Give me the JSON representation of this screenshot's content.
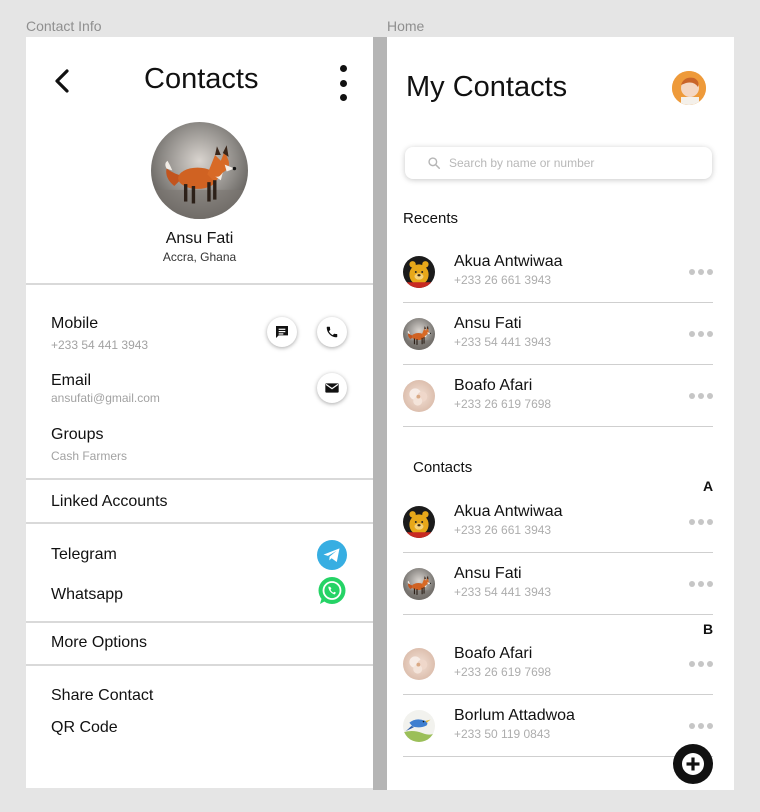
{
  "canvas": {
    "left_frame_label": "Contact Info",
    "right_frame_label": "Home"
  },
  "contact_info": {
    "title": "Contacts",
    "profile": {
      "name": "Ansu Fati",
      "location": "Accra, Ghana",
      "photo_icon": "fox-photo"
    },
    "fields": {
      "mobile": {
        "label": "Mobile",
        "value": "+233 54 441 3943"
      },
      "email": {
        "label": "Email",
        "value": "ansufati@gmail.com"
      },
      "groups": {
        "label": "Groups",
        "value": "Cash Farmers"
      }
    },
    "linked_accounts_label": "Linked Accounts",
    "accounts": [
      {
        "label": "Telegram",
        "icon": "telegram-icon",
        "color": "#37aee2"
      },
      {
        "label": "Whatsapp",
        "icon": "whatsapp-icon",
        "color": "#25d366"
      }
    ],
    "more_options_label": "More Options",
    "share_contact_label": "Share Contact",
    "qr_code_label": "QR Code"
  },
  "home": {
    "title": "My Contacts",
    "search": {
      "placeholder": "Search by name or number",
      "value": ""
    },
    "recents_label": "Recents",
    "recents": [
      {
        "name": "Akua Antwiwaa",
        "phone": "+233 26 661 3943",
        "avatar": "pooh-avatar"
      },
      {
        "name": "Ansu Fati",
        "phone": "+233 54 441 3943",
        "avatar": "fox-avatar"
      },
      {
        "name": "Boafo Afari",
        "phone": "+233 26 619 7698",
        "avatar": "flower-avatar"
      }
    ],
    "contacts_label": "Contacts",
    "letters": {
      "a": "A",
      "b": "B"
    },
    "contacts": [
      {
        "name": "Akua Antwiwaa",
        "phone": "+233 26 661 3943",
        "avatar": "pooh-avatar"
      },
      {
        "name": "Ansu Fati",
        "phone": "+233 54 441 3943",
        "avatar": "fox-avatar"
      },
      {
        "name": "Boafo Afari",
        "phone": "+233 26 619 7698",
        "avatar": "flower-avatar"
      },
      {
        "name": "Borlum Attadwoa",
        "phone": "+233 50 119 0843",
        "avatar": "bird-avatar"
      }
    ]
  }
}
